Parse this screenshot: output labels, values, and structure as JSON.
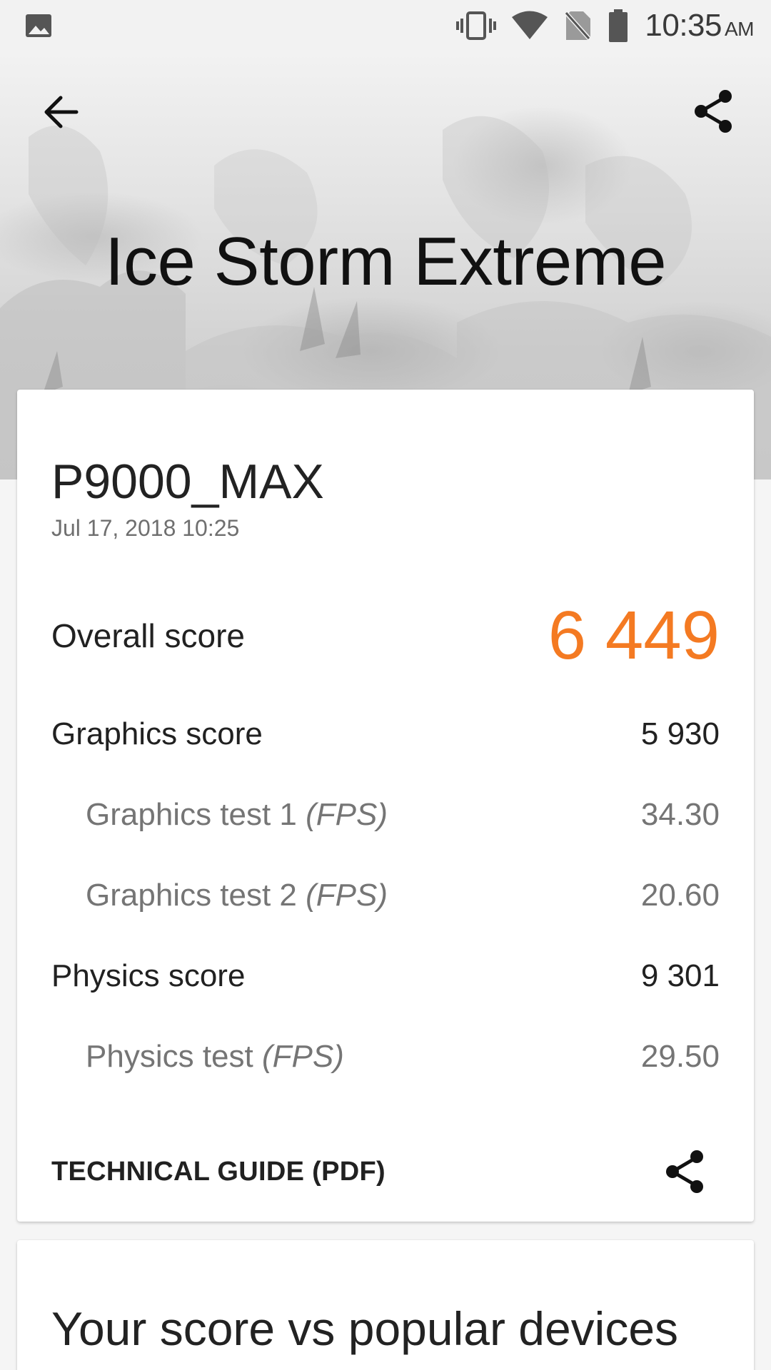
{
  "status_bar": {
    "time": "10:35",
    "ampm": "AM",
    "icons": [
      "image-icon",
      "vibrate-icon",
      "wifi-icon",
      "no-sim-icon",
      "battery-icon"
    ]
  },
  "header": {
    "title": "Ice Storm Extreme",
    "back_icon": "arrow-back-icon",
    "share_icon": "share-icon"
  },
  "result": {
    "device": "P9000_MAX",
    "date": "Jul 17, 2018 10:25",
    "overall": {
      "label": "Overall score",
      "value": "6 449"
    },
    "rows": [
      {
        "label": "Graphics score",
        "unit": "",
        "value": "5 930",
        "sub": false
      },
      {
        "label": "Graphics test 1",
        "unit": "(FPS)",
        "value": "34.30",
        "sub": true
      },
      {
        "label": "Graphics test 2",
        "unit": "(FPS)",
        "value": "20.60",
        "sub": true
      },
      {
        "label": "Physics score",
        "unit": "",
        "value": "9 301",
        "sub": false
      },
      {
        "label": "Physics test",
        "unit": "(FPS)",
        "value": "29.50",
        "sub": true
      }
    ],
    "technical_guide": "TECHNICAL GUIDE (PDF)"
  },
  "comparison": {
    "title": "Your score vs popular devices"
  },
  "colors": {
    "accent": "#f47a22",
    "secondary_text": "#757575"
  }
}
